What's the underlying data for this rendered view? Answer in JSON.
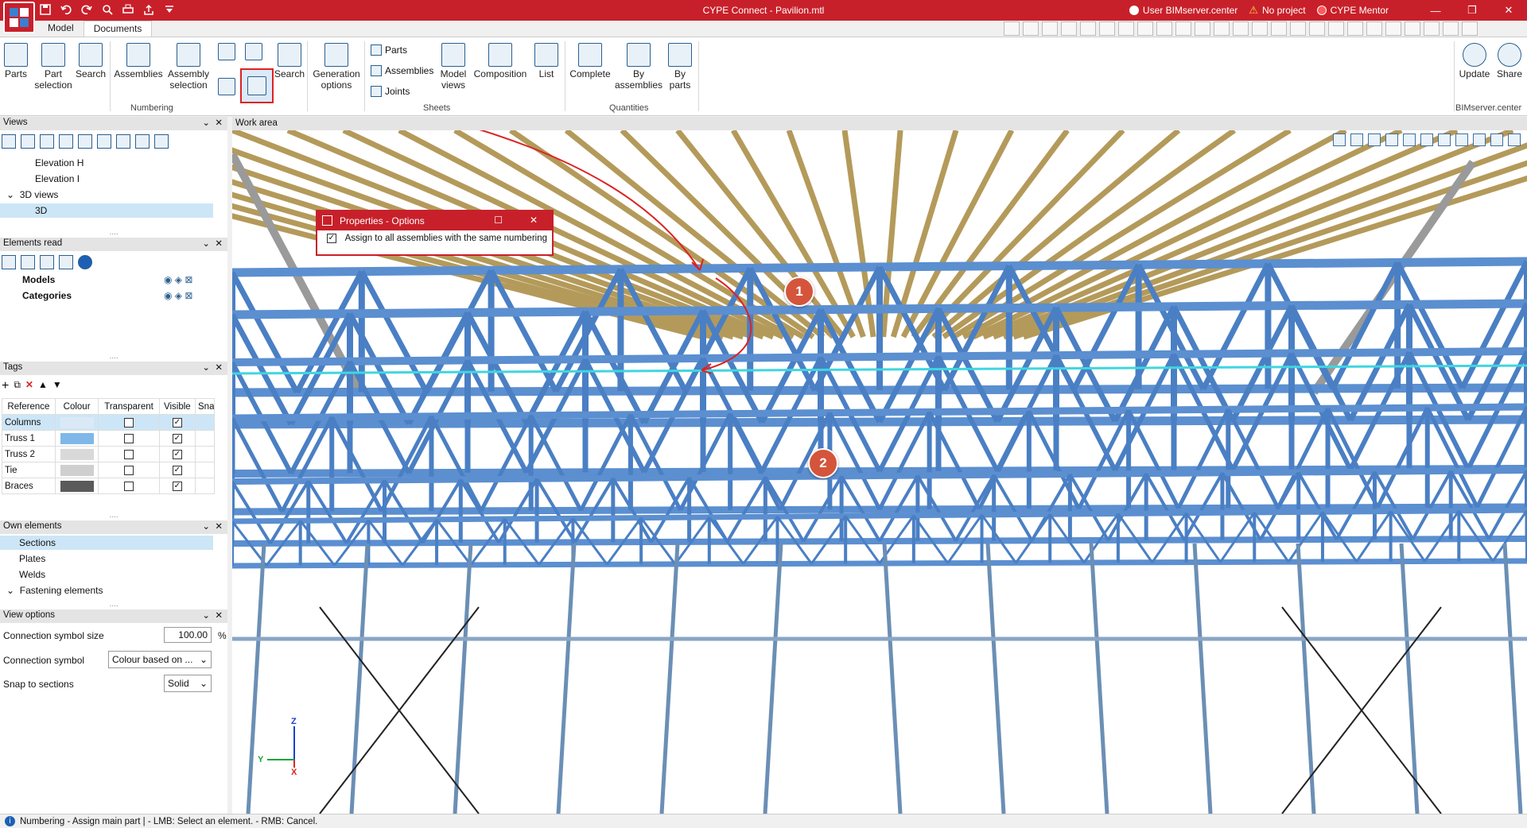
{
  "app": {
    "title": "CYPE Connect - Pavilion.mtl"
  },
  "title_right": {
    "user": "User BIMserver.center",
    "project": "No project",
    "mentor": "CYPE Mentor"
  },
  "tabs": [
    {
      "label": "Model"
    },
    {
      "label": "Documents"
    }
  ],
  "ribbon": {
    "parts": "Parts",
    "part_selection": "Part selection",
    "search1": "Search",
    "assemblies": "Assemblies",
    "assembly_selection": "Assembly selection",
    "search2": "Search",
    "generation_options": "Generation options",
    "sheets_parts": "Parts",
    "sheets_assemblies": "Assemblies",
    "sheets_joints": "Joints",
    "model_views": "Model views",
    "composition": "Composition",
    "list": "List",
    "complete": "Complete",
    "by_assemblies": "By assemblies",
    "by_parts": "By parts",
    "update": "Update",
    "share": "Share",
    "group_numbering": "Numbering",
    "group_sheets": "Sheets",
    "group_quantities": "Quantities",
    "group_bim": "BIMserver.center"
  },
  "views_panel": {
    "title": "Views",
    "items": [
      {
        "label": "Elevation H"
      },
      {
        "label": "Elevation I"
      },
      {
        "label": "3D views"
      },
      {
        "label": "3D"
      }
    ]
  },
  "elements_read": {
    "title": "Elements read",
    "items": [
      {
        "label": "Models"
      },
      {
        "label": "Categories"
      }
    ]
  },
  "tags": {
    "title": "Tags",
    "columns": [
      "Reference",
      "Colour",
      "Transparent",
      "Visible",
      "Snap"
    ],
    "rows": [
      {
        "reference": "Columns",
        "colour": "#dbe9f7",
        "transparent": false,
        "visible": true
      },
      {
        "reference": "Truss 1",
        "colour": "#7fb8e8",
        "transparent": false,
        "visible": true
      },
      {
        "reference": "Truss 2",
        "colour": "#d9d9d9",
        "transparent": false,
        "visible": true
      },
      {
        "reference": "Tie",
        "colour": "#cfcfcf",
        "transparent": false,
        "visible": true
      },
      {
        "reference": "Braces",
        "colour": "#5a5a5a",
        "transparent": false,
        "visible": true
      }
    ]
  },
  "own_elements": {
    "title": "Own elements",
    "items": [
      {
        "label": "Sections"
      },
      {
        "label": "Plates"
      },
      {
        "label": "Welds"
      },
      {
        "label": "Fastening elements"
      }
    ]
  },
  "view_options": {
    "title": "View options",
    "symbol_size_label": "Connection symbol size",
    "symbol_size_value": "100.00",
    "symbol_size_unit": "%",
    "symbol_label": "Connection symbol",
    "symbol_value": "Colour based on ...",
    "snap_label": "Snap to sections",
    "snap_value": "Solid"
  },
  "work_area": {
    "title": "Work area"
  },
  "dialog": {
    "title": "Properties - Options",
    "checkbox_label": "Assign to all assemblies with the same numbering"
  },
  "annotations": {
    "badge1": "1",
    "badge2": "2"
  },
  "axes": {
    "z": "Z",
    "y": "Y",
    "x": "X"
  },
  "status": {
    "text": "Numbering - Assign main part  |  - LMB: Select an element. - RMB: Cancel."
  }
}
